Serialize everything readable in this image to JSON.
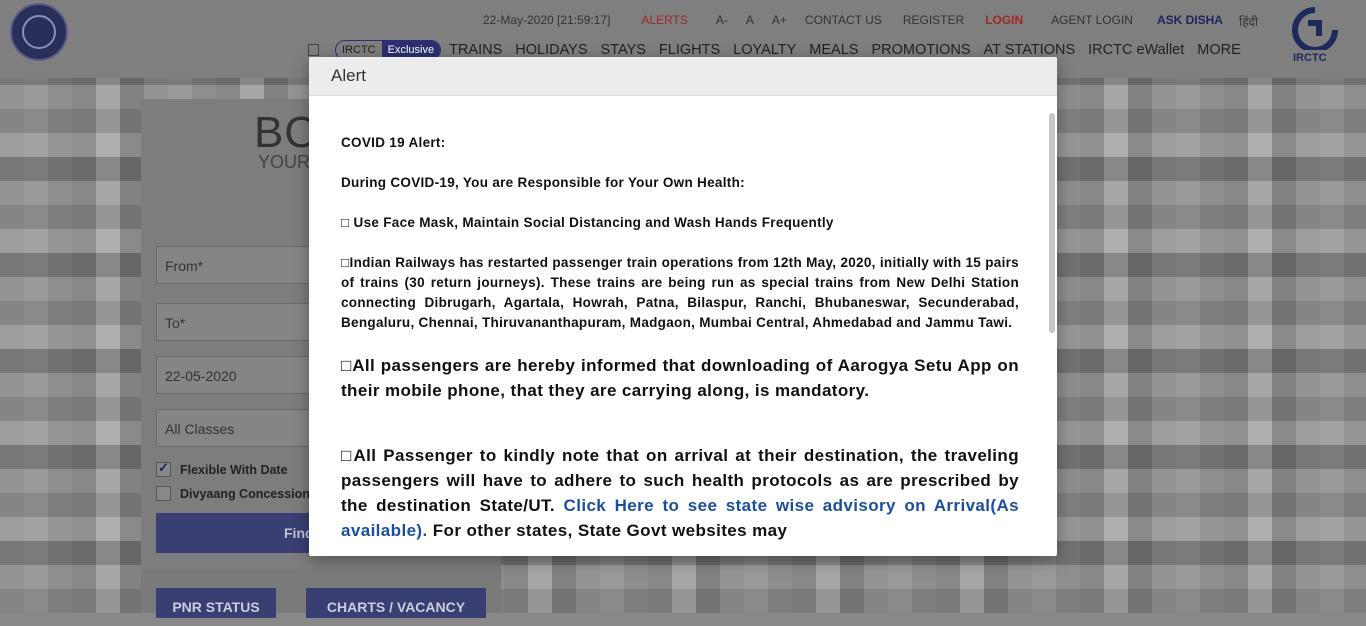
{
  "header": {
    "timestamp": "22-May-2020 [21:59:17]",
    "links": [
      {
        "label": "ALERTS",
        "color": "#c0302a"
      },
      {
        "label": "A-"
      },
      {
        "label": "A"
      },
      {
        "label": "A+"
      },
      {
        "label": "CONTACT US"
      },
      {
        "label": "REGISTER"
      },
      {
        "label": "LOGIN",
        "color": "#c0302a"
      },
      {
        "label": "AGENT LOGIN"
      },
      {
        "label": "ASK DISHA",
        "color": "#2a3070"
      },
      {
        "label": "हिंदी"
      }
    ],
    "logo_text": "IRCTC"
  },
  "nav": {
    "pill_left": "IRCTC",
    "pill_right": "Exclusive",
    "items": [
      "TRAINS",
      "HOLIDAYS",
      "STAYS",
      "FLIGHTS",
      "LOYALTY",
      "MEALS",
      "PROMOTIONS",
      "AT STATIONS",
      "IRCTC eWallet",
      "MORE"
    ]
  },
  "booking": {
    "title": "BO",
    "subtitle": "YOUR",
    "from_placeholder": "From*",
    "to_placeholder": "To*",
    "date_value": "22-05-2020",
    "class_value": "All Classes",
    "flexible_label": "Flexible With Date",
    "flexible_checked": true,
    "divyaang_label": "Divyaang Concession",
    "find_button": "Find",
    "pnr_button": "PNR STATUS",
    "charts_button": "CHARTS / VACANCY"
  },
  "modal": {
    "title": "Alert",
    "p1": "COVID 19 Alert:",
    "p2": "During COVID-19, You are Responsible for Your Own Health:",
    "p3": " Use Face Mask, Maintain Social Distancing and Wash Hands Frequently",
    "p4": "Indian Railways has restarted passenger train operations from 12th May, 2020, initially with 15 pairs of trains (30 return journeys). These trains are being run as special trains from New Delhi Station connecting Dibrugarh, Agartala, Howrah, Patna, Bilaspur, Ranchi, Bhubaneswar, Secunderabad, Bengaluru, Chennai, Thiruvananthapuram, Madgaon, Mumbai Central, Ahmedabad and Jammu Tawi.",
    "p5": "All passengers are hereby informed that downloading of Aarogya Setu App on their mobile phone, that they are carrying along, is mandatory.",
    "p6_before": "All Passenger to kindly note that on arrival at their destination, the traveling passengers will have to adhere to such health protocols as are prescribed by the destination State/UT. ",
    "p6_link": "Click Here to see state wise advisory on Arrival(As available).",
    "p6_after": " For other states, State Govt websites may"
  }
}
